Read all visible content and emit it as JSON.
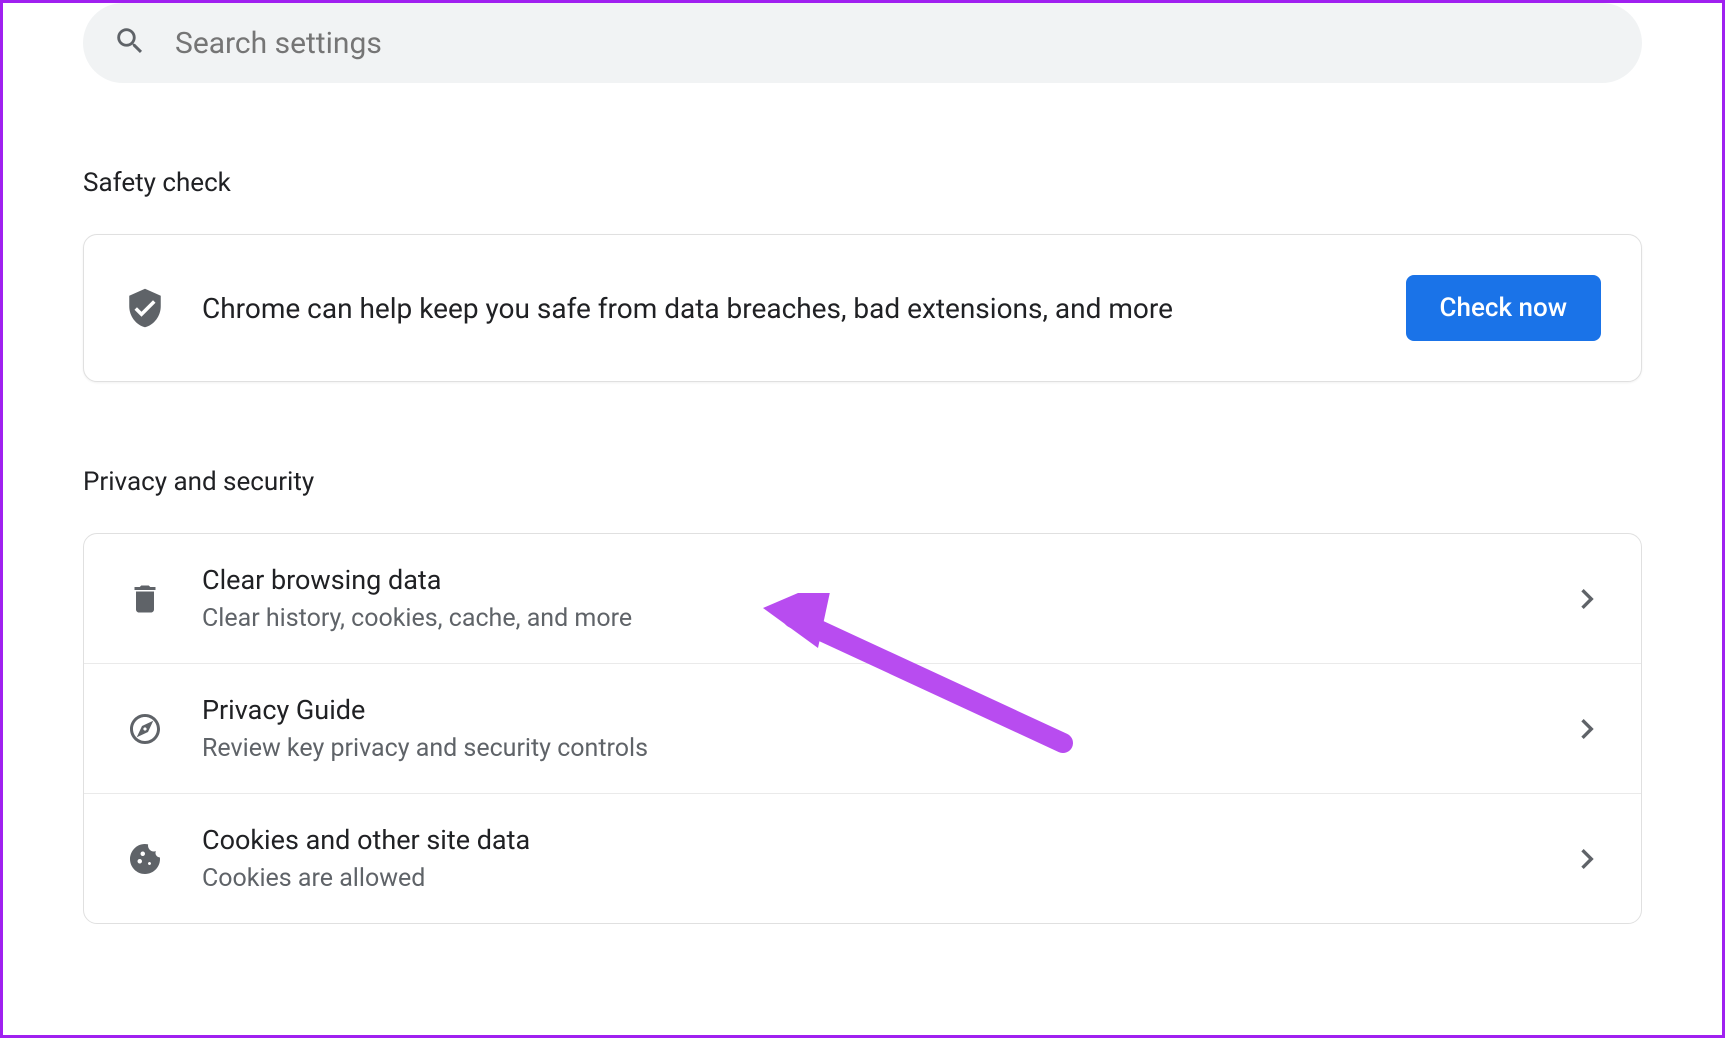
{
  "search": {
    "placeholder": "Search settings"
  },
  "safety_check": {
    "title": "Safety check",
    "description": "Chrome can help keep you safe from data breaches, bad extensions, and more",
    "button_label": "Check now"
  },
  "privacy_security": {
    "title": "Privacy and security",
    "items": [
      {
        "title": "Clear browsing data",
        "subtitle": "Clear history, cookies, cache, and more"
      },
      {
        "title": "Privacy Guide",
        "subtitle": "Review key privacy and security controls"
      },
      {
        "title": "Cookies and other site data",
        "subtitle": "Cookies are allowed"
      }
    ]
  }
}
